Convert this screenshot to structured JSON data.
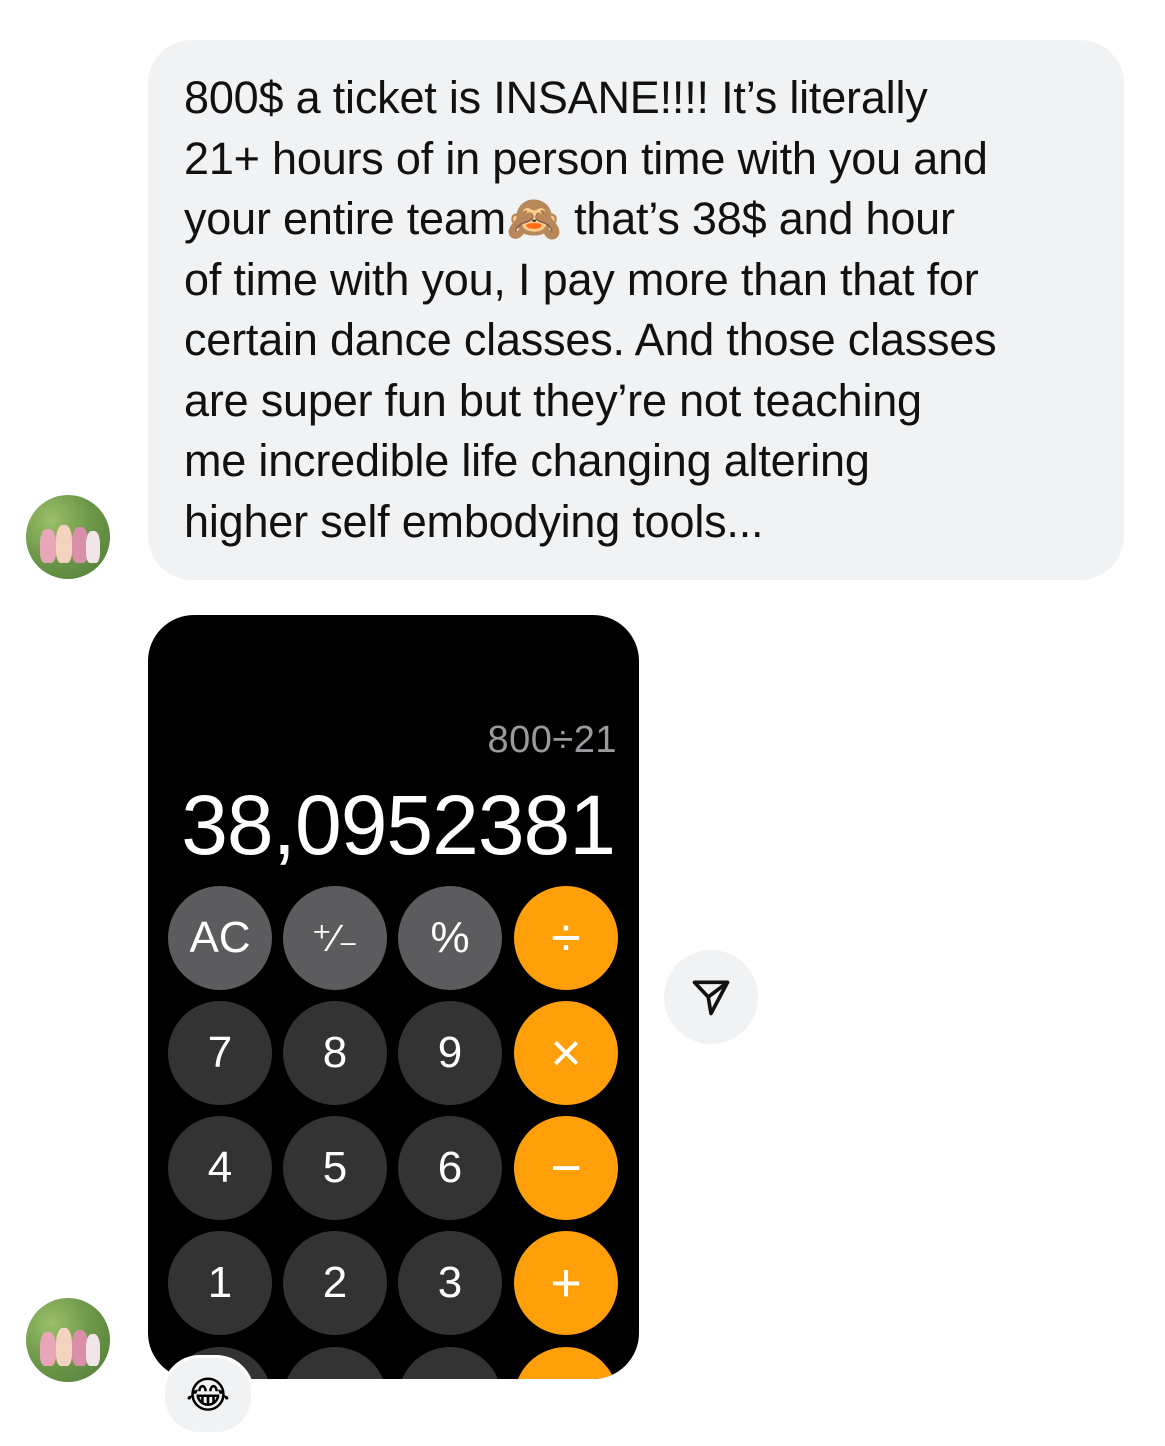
{
  "messages": [
    {
      "type": "text",
      "text": "800$ a ticket is INSANE!!!! It’s literally\n21+ hours of in person time with you and\nyour entire team🙈 that’s 38$ and hour\nof time with you, I pay more than that for\ncertain dance classes. And those classes\nare super fun but they’re not teaching\nme incredible life changing altering\nhigher self embodying tools..."
    },
    {
      "type": "image",
      "calculator": {
        "expression": "800÷21",
        "result": "38,0952381",
        "keys": {
          "ac": "AC",
          "plus_minus": "⁺∕₋",
          "percent": "%",
          "divide": "÷",
          "seven": "7",
          "eight": "8",
          "nine": "9",
          "multiply": "×",
          "four": "4",
          "five": "5",
          "six": "6",
          "minus": "−",
          "one": "1",
          "two": "2",
          "three": "3",
          "plus": "+"
        }
      },
      "reaction": "😂"
    }
  ],
  "icons": {
    "share": "paper-plane-icon",
    "avatar": "avatar-photo"
  },
  "colors": {
    "bubble": "#f1f2f4",
    "operator": "#ff9f0a",
    "calc_bg": "#000000"
  }
}
